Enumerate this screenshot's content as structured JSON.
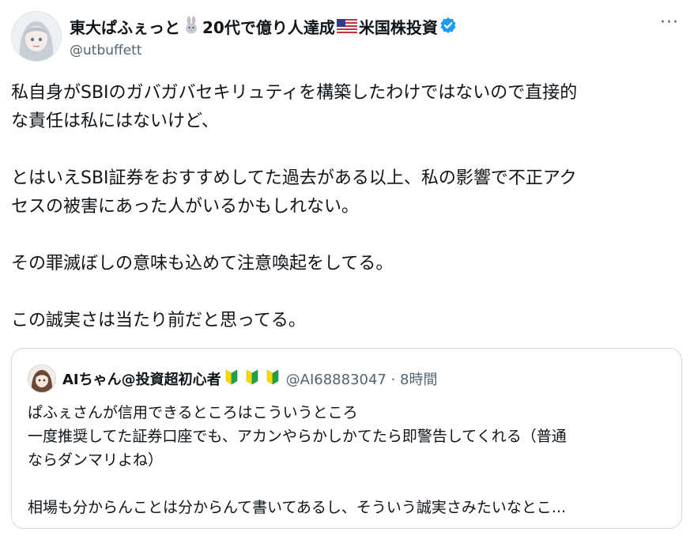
{
  "author": {
    "name_prefix": "東大ぱふぇっと",
    "name_middle": "20代で億り人達成",
    "name_suffix": "米国株投資",
    "handle": "@utbuffett",
    "icons": [
      "rabbit-emoji-icon",
      "us-flag-icon",
      "verified-badge-icon"
    ]
  },
  "more_label": "···",
  "tweet": {
    "lines": [
      "私自身がSBIのガバガバセキリュティを構築したわけではないので直接的",
      "な責任は私にはないけど、",
      "とはいえSBI証券をおすすめしてた過去がある以上、私の影響で不正アク",
      "セスの被害にあった人がいるかもしれない。",
      "その罪滅ぼしの意味も込めて注意喚起をしてる。",
      "この誠実さは当たり前だと思ってる。"
    ]
  },
  "quote": {
    "name": "AIちゃん@投資超初心者",
    "meta": "@AI68883047 · 8時間",
    "icons": [
      "beginner-mark-icon"
    ],
    "lines": [
      "ぱふぇさんが信用できるところはこういうところ",
      "一度推奨してた証券口座でも、アカンやらかしかてたら即警告してくれる（普通",
      "ならダンマリよね）",
      "相場も分からんことは分からんて書いてあるし、そういう誠実さみたいなとこ..."
    ]
  },
  "colors": {
    "text": "#0f1419",
    "secondary": "#536471",
    "verified": "#1d9bf0",
    "border": "#cfd9de"
  }
}
